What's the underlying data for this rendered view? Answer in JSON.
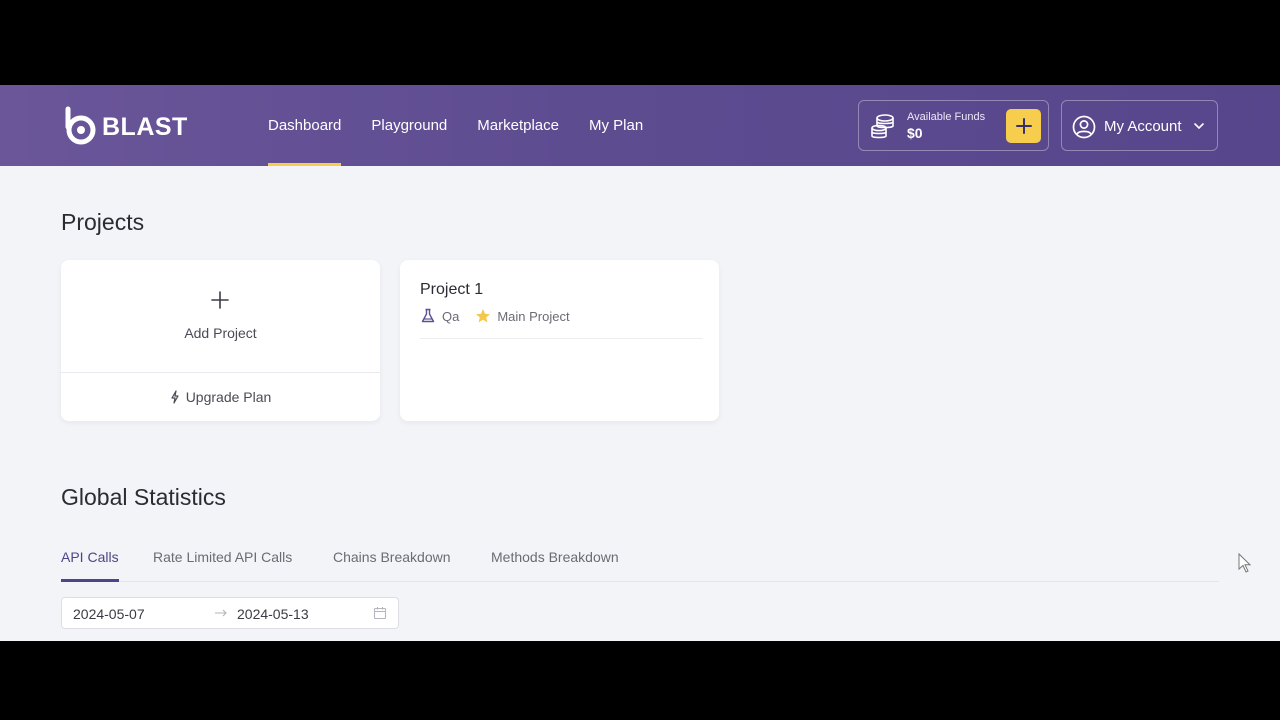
{
  "header": {
    "logo_text": "BLAST",
    "nav": [
      {
        "label": "Dashboard",
        "active": true
      },
      {
        "label": "Playground",
        "active": false
      },
      {
        "label": "Marketplace",
        "active": false
      },
      {
        "label": "My Plan",
        "active": false
      }
    ],
    "funds": {
      "label": "Available Funds",
      "value": "$0",
      "add_icon": "plus-icon"
    },
    "account": {
      "label": "My Account",
      "icon": "user-circle-icon",
      "chevron": "chevron-down-icon"
    }
  },
  "projects": {
    "title": "Projects",
    "add_card": {
      "label": "Add Project",
      "upgrade_label": "Upgrade Plan"
    },
    "items": [
      {
        "name": "Project 1",
        "environment": "Qa",
        "badge": "Main Project"
      }
    ]
  },
  "stats": {
    "title": "Global Statistics",
    "tabs": [
      {
        "label": "API Calls",
        "active": true
      },
      {
        "label": "Rate Limited API Calls",
        "active": false
      },
      {
        "label": "Chains Breakdown",
        "active": false
      },
      {
        "label": "Methods Breakdown",
        "active": false
      }
    ],
    "date_range": {
      "start": "2024-05-07",
      "end": "2024-05-13"
    }
  },
  "colors": {
    "header_bg": "#5e4c91",
    "accent_yellow": "#f7cd4d",
    "tab_active": "#4e4486",
    "page_bg": "#f3f4f8"
  }
}
